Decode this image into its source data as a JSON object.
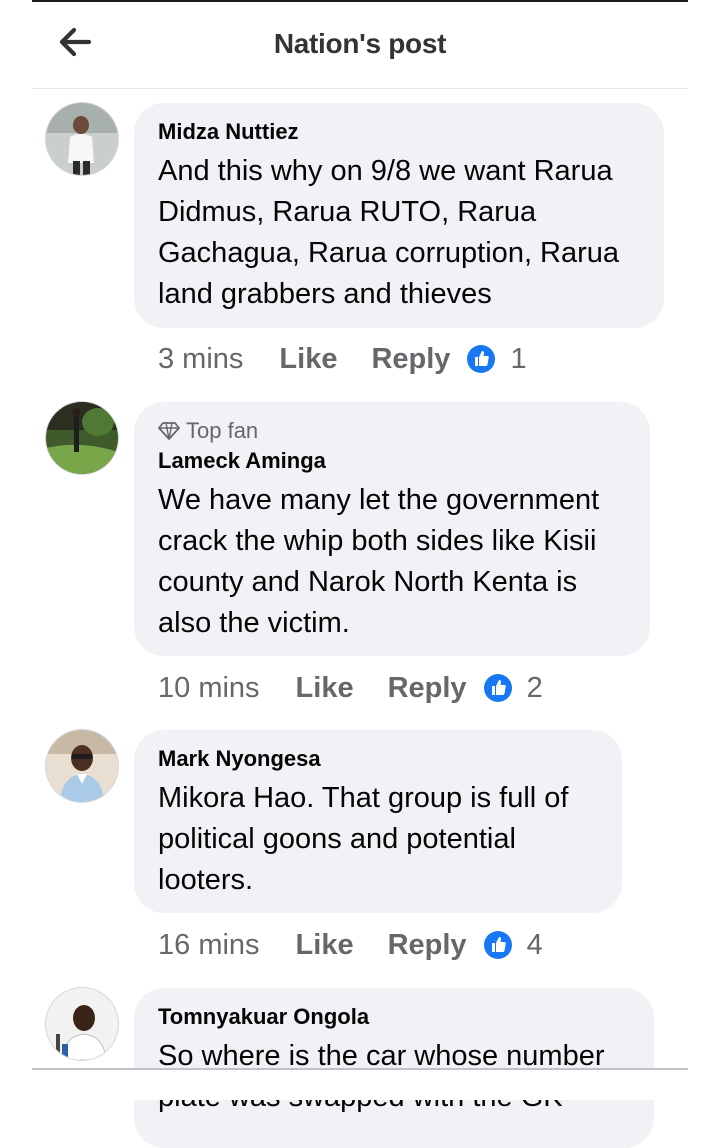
{
  "header": {
    "title": "Nation's post",
    "back_icon": "arrow-left-icon"
  },
  "comments": [
    {
      "author": "Midza Nuttiez",
      "badge": "",
      "text": "And this why on 9/8 we want Rarua Didmus, Rarua RUTO, Rarua Gachagua, Rarua corruption, Rarua land grabbers and thieves",
      "time": "3 mins",
      "like_label": "Like",
      "reply_label": "Reply",
      "reactions": "1"
    },
    {
      "author": "Lameck Aminga",
      "badge": "Top fan",
      "text": "We have many let the government crack the whip both sides like Kisii county and Narok North Kenta is also the victim.",
      "time": "10 mins",
      "like_label": "Like",
      "reply_label": "Reply",
      "reactions": "2"
    },
    {
      "author": "Mark Nyongesa",
      "badge": "",
      "text": "Mikora Hao. That group is full of political goons and potential looters.",
      "time": "16 mins",
      "like_label": "Like",
      "reply_label": "Reply",
      "reactions": "4"
    },
    {
      "author": "Tomnyakuar Ongola",
      "badge": "",
      "text": "So where is the car whose number plate was swapped with the GK",
      "time": "",
      "like_label": "",
      "reply_label": "",
      "reactions": ""
    }
  ],
  "colors": {
    "like_blue": "#1877f2",
    "bubble_bg": "#f0f2f5",
    "meta_gray": "#65676b"
  }
}
